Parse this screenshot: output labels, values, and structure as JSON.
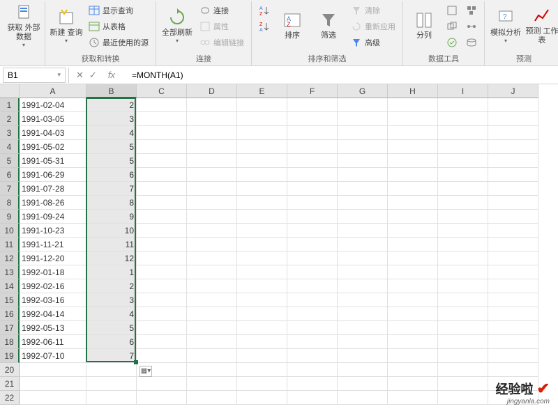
{
  "ribbon": {
    "groups": {
      "external": {
        "label": "",
        "get_data": "获取\n外部数据"
      },
      "transform": {
        "label": "获取和转换",
        "new_query": "新建\n查询",
        "show_query": "显示查询",
        "from_table": "从表格",
        "recent": "最近使用的源"
      },
      "connections": {
        "label": "连接",
        "refresh_all": "全部刷新",
        "conn": "连接",
        "props": "属性",
        "edit_links": "编辑链接"
      },
      "sortfilter": {
        "label": "排序和筛选",
        "sort_asc": "A↓Z",
        "sort_desc": "Z↓A",
        "sort": "排序",
        "filter": "筛选",
        "clear": "清除",
        "reapply": "重新应用",
        "advanced": "高级"
      },
      "datatools": {
        "label": "数据工具",
        "text_to_cols": "分列"
      },
      "forecast": {
        "label": "预测",
        "whatif": "模拟分析",
        "sheet": "预测\n工作表"
      }
    }
  },
  "namebox": {
    "value": "B1"
  },
  "formula": {
    "value": "=MONTH(A1)"
  },
  "columns": [
    {
      "letter": "A",
      "width": 96
    },
    {
      "letter": "B",
      "width": 72
    },
    {
      "letter": "C",
      "width": 72
    },
    {
      "letter": "D",
      "width": 72
    },
    {
      "letter": "E",
      "width": 72
    },
    {
      "letter": "F",
      "width": 72
    },
    {
      "letter": "G",
      "width": 72
    },
    {
      "letter": "H",
      "width": 72
    },
    {
      "letter": "I",
      "width": 72
    },
    {
      "letter": "J",
      "width": 72
    }
  ],
  "rows": [
    {
      "n": 1,
      "a": "1991-02-04",
      "b": "2"
    },
    {
      "n": 2,
      "a": "1991-03-05",
      "b": "3"
    },
    {
      "n": 3,
      "a": "1991-04-03",
      "b": "4"
    },
    {
      "n": 4,
      "a": "1991-05-02",
      "b": "5"
    },
    {
      "n": 5,
      "a": "1991-05-31",
      "b": "5"
    },
    {
      "n": 6,
      "a": "1991-06-29",
      "b": "6"
    },
    {
      "n": 7,
      "a": "1991-07-28",
      "b": "7"
    },
    {
      "n": 8,
      "a": "1991-08-26",
      "b": "8"
    },
    {
      "n": 9,
      "a": "1991-09-24",
      "b": "9"
    },
    {
      "n": 10,
      "a": "1991-10-23",
      "b": "10"
    },
    {
      "n": 11,
      "a": "1991-11-21",
      "b": "11"
    },
    {
      "n": 12,
      "a": "1991-12-20",
      "b": "12"
    },
    {
      "n": 13,
      "a": "1992-01-18",
      "b": "1"
    },
    {
      "n": 14,
      "a": "1992-02-16",
      "b": "2"
    },
    {
      "n": 15,
      "a": "1992-03-16",
      "b": "3"
    },
    {
      "n": 16,
      "a": "1992-04-14",
      "b": "4"
    },
    {
      "n": 17,
      "a": "1992-05-13",
      "b": "5"
    },
    {
      "n": 18,
      "a": "1992-06-11",
      "b": "6"
    },
    {
      "n": 19,
      "a": "1992-07-10",
      "b": "7"
    },
    {
      "n": 20,
      "a": "",
      "b": ""
    },
    {
      "n": 21,
      "a": "",
      "b": ""
    },
    {
      "n": 22,
      "a": "",
      "b": ""
    }
  ],
  "selection": {
    "col": "B",
    "row_start": 1,
    "row_end": 19
  },
  "watermark": {
    "text": "经验啦",
    "sub": "jingyanla.com"
  }
}
